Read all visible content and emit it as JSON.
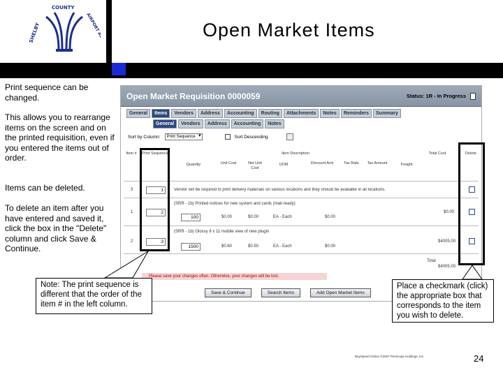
{
  "slide": {
    "title": "Open Market Items",
    "page_number": "24",
    "footer": "BuySpeed Online ©2007 Periscope Holdings, Inc."
  },
  "logo": {
    "text_left": "SHELBY",
    "text_top": "COUNTY",
    "text_right": "AIRPORT AUTHORITY"
  },
  "left_text": {
    "p1": "Print sequence can be changed.",
    "p2": "This allows you to rearrange items on the screen and on the printed requisition, even if you entered the items out of order.",
    "p3": "Items can be deleted.",
    "p4": "To delete an item after you have entered and saved it, click the box in the \"Delete\" column and click Save & Continue."
  },
  "screenshot": {
    "title": "Open Market Requisition 0000059",
    "status": "Status: 1R - In Progress",
    "tabs": [
      "General",
      "Items",
      "Vendors",
      "Address",
      "Accounting",
      "Routing",
      "Attachments",
      "Notes",
      "Reminders",
      "Summary"
    ],
    "active_tab": "Items",
    "subtabs": [
      "General",
      "Vendors",
      "Address",
      "Accounting",
      "Notes"
    ],
    "active_subtab": "General",
    "sort_label": "Sort by Column:",
    "sort_value": "Print Sequence",
    "sort_desc_label": "Sort Descending",
    "headers": {
      "item": "Item #",
      "print_seq": "Print Sequence",
      "desc": "Item Description",
      "quantity": "Quantity",
      "unit_cost": "Unit Cost",
      "net_unit_cost": "Net Unit Cost",
      "uom": "UOM",
      "discount": "Discount Amt",
      "tax_rate": "Tax Rate",
      "tax_amount": "Tax Amount",
      "freight": "Freight",
      "total_cost": "Total Cost",
      "delete": "Delete"
    },
    "rows": [
      {
        "item": "3",
        "seq": "1",
        "desc": "Vendor will be required to print delivery materials on various locations and they should be available in all locations.",
        "qty": "",
        "unit": "",
        "net": "",
        "uom": "",
        "disc": "",
        "total": ""
      },
      {
        "item": "1",
        "seq": "2",
        "desc": "(SRR - 1b) Printed notices for new system and cards (mail-ready)",
        "qty": "100",
        "unit": "$0.00",
        "net": "$0.00",
        "uom": "EA - Each",
        "disc": "$0.00",
        "total": "$0.00"
      },
      {
        "item": "2",
        "seq": "3",
        "desc": "(SRR - 1b) Glossy 8 x 11 mobile view of new plugin",
        "qty": "1500",
        "unit": "$0.60",
        "net": "$0.50",
        "uom": "EA - Each",
        "disc": "$0.00",
        "total": "$4005.00"
      }
    ],
    "total_label": "Total",
    "total_value": "$4005.00",
    "warning": "Please save your changes often. Otherwise, your changes will be lost.",
    "buttons": [
      "Save & Continue",
      "Search Items",
      "Add Open Market Items"
    ]
  },
  "callouts": {
    "left": "Note: The print sequence is different that the order of the item # in the left column.",
    "right": "Place a checkmark (click) the appropriate box that corresponds to the item you wish to delete."
  },
  "colors": {
    "accent_blue": "#1a2bd6",
    "header_gray": "#8794a4",
    "active_tab": "#2c4a80"
  }
}
